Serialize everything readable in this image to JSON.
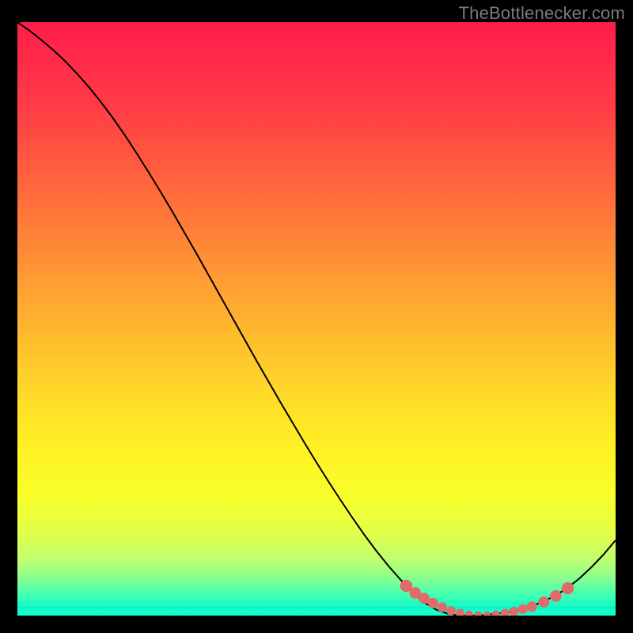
{
  "attribution": "TheBottlenecker.com",
  "chart_data": {
    "type": "line",
    "title": "",
    "xlabel": "",
    "ylabel": "",
    "xlim": [
      0,
      100
    ],
    "ylim": [
      0,
      100
    ],
    "categories": [
      0,
      2,
      4,
      6,
      8,
      10,
      12,
      14,
      16,
      18,
      20,
      22,
      24,
      26,
      28,
      30,
      32,
      34,
      36,
      38,
      40,
      42,
      44,
      46,
      48,
      50,
      52,
      54,
      56,
      58,
      60,
      62,
      64,
      66,
      68,
      70,
      72,
      74,
      76,
      78,
      80,
      82,
      84,
      86,
      88,
      90,
      92,
      94,
      96,
      98,
      100
    ],
    "values": [
      100,
      98.6,
      97.0,
      95.3,
      93.4,
      91.3,
      89.0,
      86.5,
      83.8,
      80.9,
      77.8,
      74.6,
      71.3,
      67.9,
      64.4,
      60.9,
      57.3,
      53.7,
      50.1,
      46.5,
      42.9,
      39.4,
      35.9,
      32.5,
      29.1,
      25.8,
      22.6,
      19.5,
      16.5,
      13.6,
      10.9,
      8.4,
      6.1,
      4.0,
      2.2,
      1.0,
      0.3,
      0.0,
      0.0,
      0.1,
      0.3,
      0.6,
      1.0,
      1.6,
      2.4,
      3.4,
      4.7,
      6.3,
      8.2,
      10.3,
      12.7
    ],
    "markers": {
      "x": [
        65,
        66.5,
        68,
        69.5,
        71,
        72.5,
        74,
        75.5,
        77,
        78.5,
        80,
        81.5,
        83,
        84.5,
        86,
        88,
        90,
        92
      ],
      "y": [
        5.0,
        3.8,
        2.9,
        2.1,
        1.4,
        0.8,
        0.4,
        0.2,
        0.1,
        0.1,
        0.2,
        0.4,
        0.7,
        1.1,
        1.5,
        2.3,
        3.3,
        4.6
      ],
      "color": "#e26a6a"
    },
    "background": {
      "type": "vertical-gradient",
      "stops": [
        {
          "offset": 0.0,
          "color": "#ff1d4b"
        },
        {
          "offset": 0.15,
          "color": "#ff3e45"
        },
        {
          "offset": 0.3,
          "color": "#ff6e3b"
        },
        {
          "offset": 0.45,
          "color": "#ffa132"
        },
        {
          "offset": 0.6,
          "color": "#ffd22a"
        },
        {
          "offset": 0.72,
          "color": "#fff224"
        },
        {
          "offset": 0.8,
          "color": "#f8ff2a"
        },
        {
          "offset": 0.86,
          "color": "#e2ff4a"
        },
        {
          "offset": 0.905,
          "color": "#c0ff6d"
        },
        {
          "offset": 0.935,
          "color": "#8cff8e"
        },
        {
          "offset": 0.96,
          "color": "#4fffad"
        },
        {
          "offset": 0.98,
          "color": "#1effc3"
        },
        {
          "offset": 1.0,
          "color": "#0bffcd"
        }
      ]
    },
    "green_bands": [
      {
        "y0": 0.975,
        "y1": 0.981,
        "color": "#27f8be"
      },
      {
        "y0": 0.984,
        "y1": 0.99,
        "color": "#0bf5ca"
      }
    ],
    "line_color": "#000000",
    "line_width": 2
  }
}
